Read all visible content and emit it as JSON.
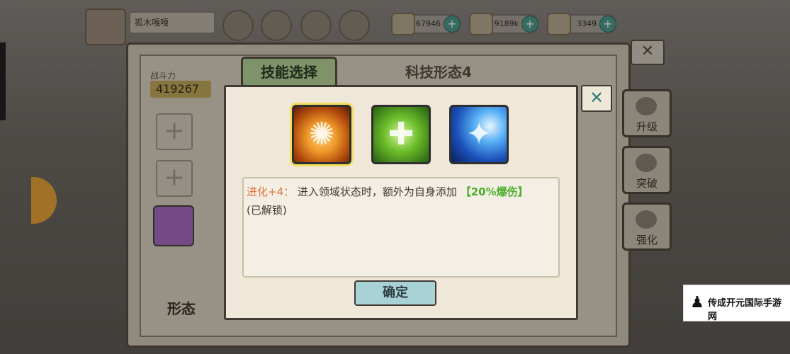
{
  "top_bar": {
    "player_name": "狐木嘎嘎",
    "resources": [
      {
        "icon": "gem-icon",
        "value": "67946"
      },
      {
        "icon": "bandage-icon",
        "value": "9189k"
      },
      {
        "icon": "scroll-icon",
        "value": "3349"
      }
    ]
  },
  "book": {
    "tab_label": "技能选择",
    "title": "科技形态4",
    "power_label": "战斗力",
    "power_value": "419267",
    "slot_plus": "+",
    "close_glyph": "✕",
    "right_buttons": [
      {
        "label": "升级",
        "icon": "upgrade-icon"
      },
      {
        "label": "突破",
        "icon": "breakthrough-icon"
      },
      {
        "label": "强化",
        "icon": "enhance-icon"
      }
    ],
    "bottom_tabs": [
      "形态"
    ]
  },
  "dialog": {
    "close_glyph": "✕",
    "skills": [
      {
        "name": "fire-vortex-skill",
        "icon": "fire-icon",
        "selected": true
      },
      {
        "name": "heal-skill",
        "icon": "heal-icon",
        "selected": false
      },
      {
        "name": "star-burst-skill",
        "icon": "star-icon",
        "selected": false
      }
    ],
    "description": {
      "prefix": "进化+4：",
      "body": "进入领域状态时，额外为自身添加",
      "highlight": "【20%爆伤】",
      "suffix": "(已解锁)"
    },
    "confirm_label": "确定"
  },
  "watermark": {
    "text": "传成开元国际手游网"
  },
  "colors": {
    "accent_highlight": "#4caf2a",
    "accent_prefix": "#e0753a",
    "confirm_button": "#a8d2d6",
    "selected_border": "#f6de5d"
  }
}
